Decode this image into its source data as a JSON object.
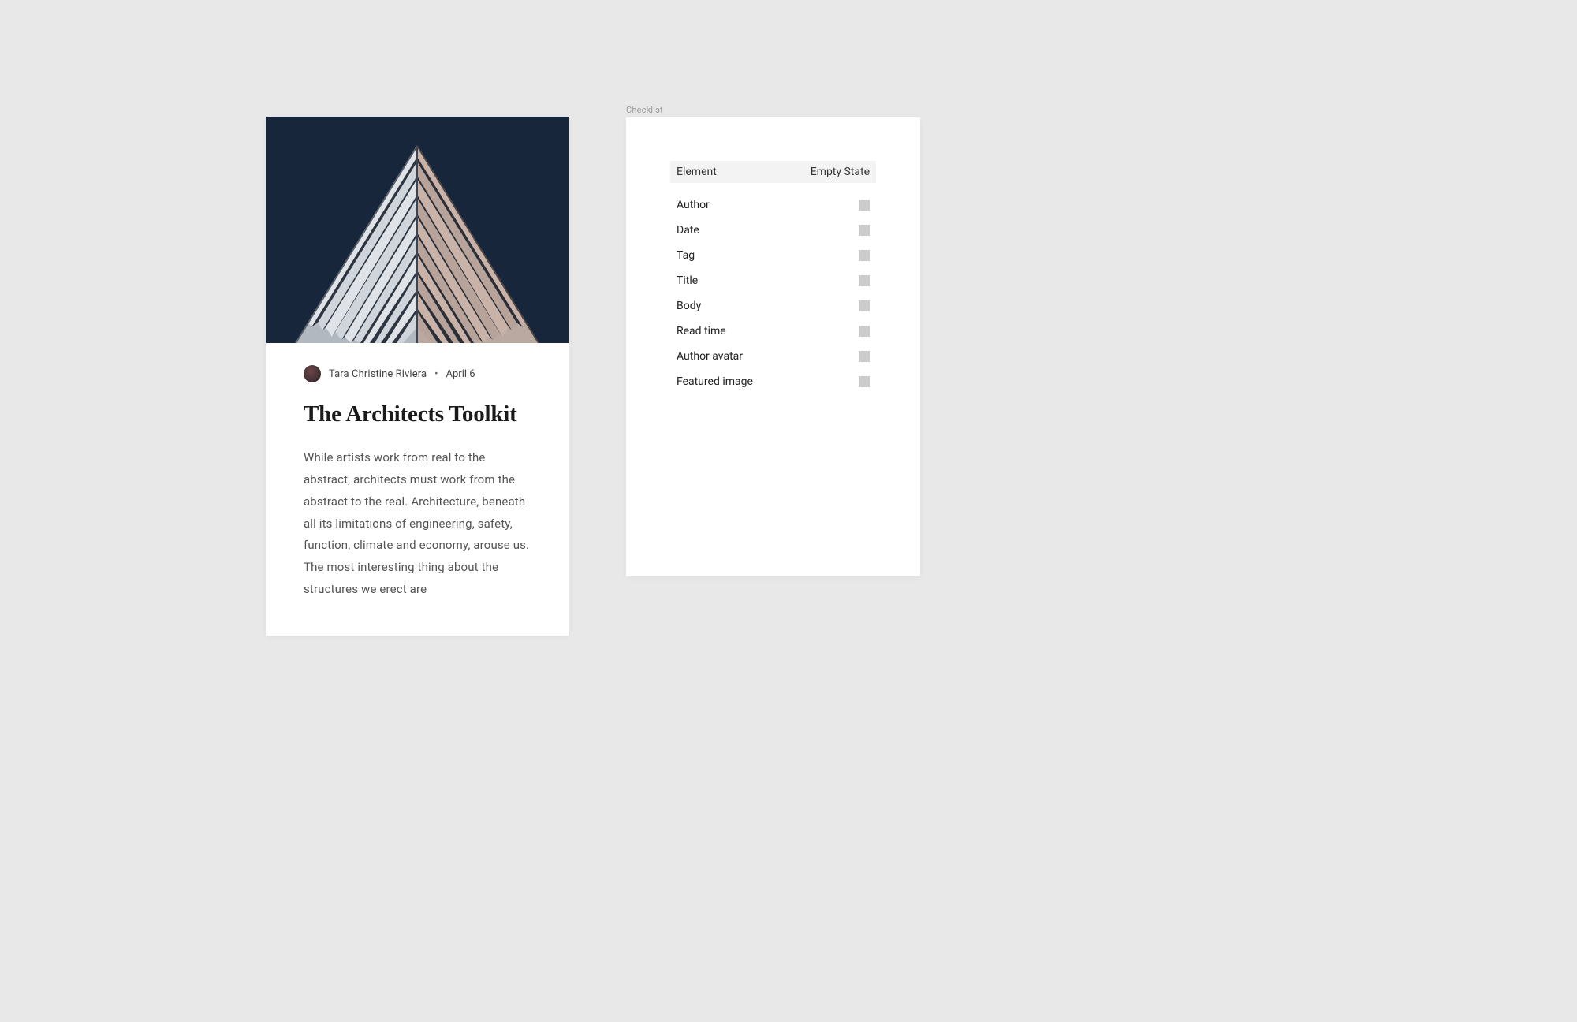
{
  "article": {
    "author": "Tara Christine Riviera",
    "date": "April 6",
    "title": "The Architects Toolkit",
    "body": "While artists work from real to the abstract, architects must work from the abstract to the real. Architecture, beneath all its limitations of engineering, safety, function, climate and economy, arouse us. The most interesting thing about the structures we erect are"
  },
  "checklist": {
    "label": "Checklist",
    "header": {
      "element": "Element",
      "empty_state": "Empty State"
    },
    "rows": [
      {
        "name": "Author"
      },
      {
        "name": "Date"
      },
      {
        "name": "Tag"
      },
      {
        "name": "Title"
      },
      {
        "name": "Body"
      },
      {
        "name": "Read time"
      },
      {
        "name": "Author avatar"
      },
      {
        "name": "Featured image"
      }
    ]
  }
}
